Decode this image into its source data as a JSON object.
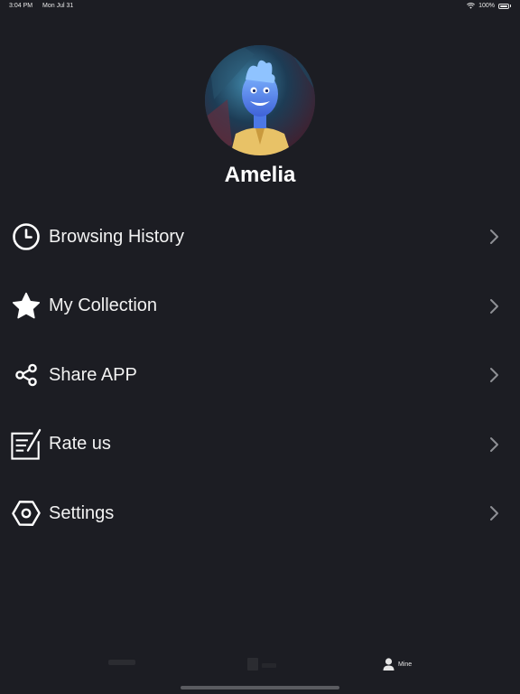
{
  "status_bar": {
    "time": "3:04 PM",
    "date": "Mon Jul 31",
    "battery": "100%"
  },
  "profile": {
    "name": "Amelia",
    "avatar_icon": "character-avatar"
  },
  "menu": {
    "items": [
      {
        "label": "Browsing History",
        "icon": "clock-icon"
      },
      {
        "label": "My Collection",
        "icon": "star-icon"
      },
      {
        "label": "Share APP",
        "icon": "share-icon"
      },
      {
        "label": "Rate us",
        "icon": "edit-note-icon"
      },
      {
        "label": "Settings",
        "icon": "hexagon-gear-icon"
      }
    ]
  },
  "tab_bar": {
    "tabs": [
      {
        "label": "",
        "icon": "home-icon",
        "active": false
      },
      {
        "label": "",
        "icon": "library-icon",
        "active": false
      },
      {
        "label": "Mine",
        "icon": "person-icon",
        "active": true
      }
    ]
  },
  "colors": {
    "background": "#1c1d23",
    "text": "#f2f2f2",
    "chevron": "#8e8f94",
    "inactive_tab": "#3a3b40"
  }
}
